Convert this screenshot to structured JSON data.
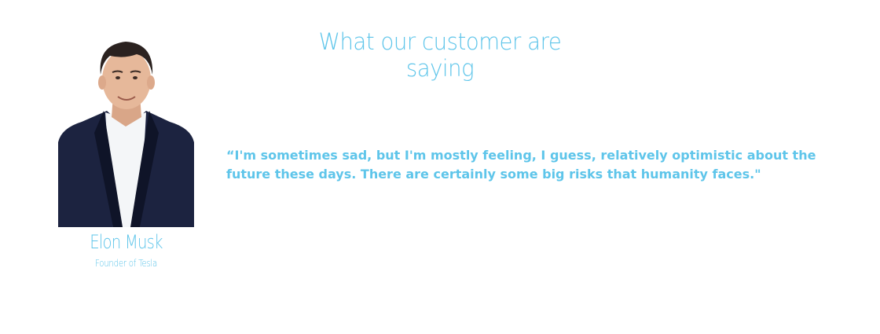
{
  "testimonials": {
    "title": "What our customer are saying",
    "quote": "“I'm sometimes sad, but I'm mostly feeling, I guess, relatively optimistic about the future these days. There are certainly some big risks that humanity faces.\"",
    "person": {
      "name": "Elon Musk",
      "role": "Founder of Tesla"
    }
  },
  "colors": {
    "accent": "#5ec5ea",
    "suit": "#1c2340",
    "shirt": "#f4f6f8",
    "skin": "#e6b89a",
    "hair": "#2b2220"
  }
}
